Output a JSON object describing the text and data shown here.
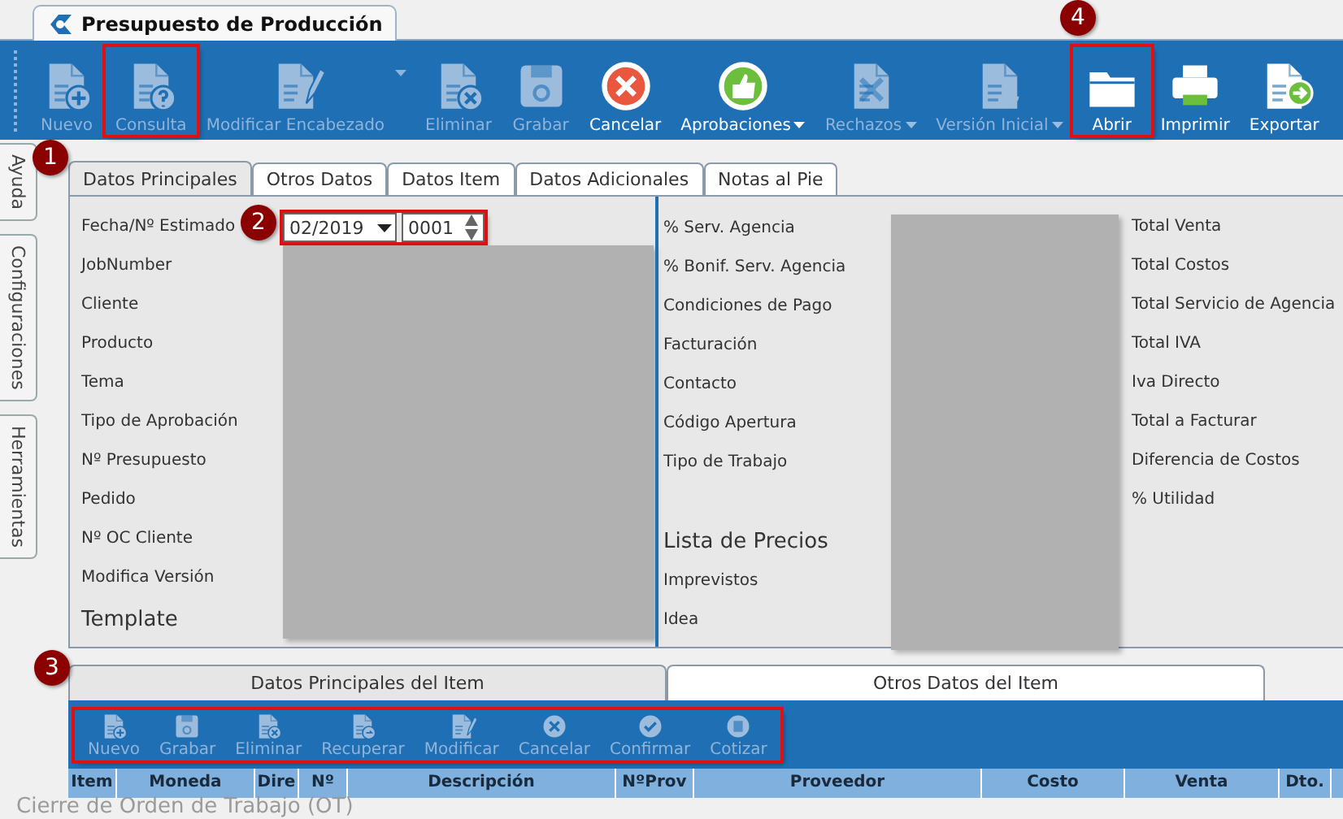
{
  "window": {
    "title": "Presupuesto de Producción"
  },
  "toolbar": [
    {
      "label": "Nuevo",
      "disabled": true,
      "highlighted": false
    },
    {
      "label": "Consulta",
      "disabled": true,
      "highlighted": true
    },
    {
      "label": "Modificar Encabezado",
      "disabled": true,
      "highlighted": false,
      "split_menu": true
    },
    {
      "label": "Eliminar",
      "disabled": true,
      "highlighted": false
    },
    {
      "label": "Grabar",
      "disabled": true,
      "highlighted": false
    },
    {
      "label": "Cancelar",
      "disabled": false,
      "highlighted": false
    },
    {
      "label": "Aprobaciones",
      "disabled": false,
      "highlighted": false,
      "dropdown": true
    },
    {
      "label": "Rechazos",
      "disabled": true,
      "highlighted": false,
      "dropdown": true
    },
    {
      "label": "Versión Inicial",
      "disabled": true,
      "highlighted": false,
      "dropdown": true
    },
    {
      "label": "Abrir",
      "disabled": false,
      "highlighted": true
    },
    {
      "label": "Imprimir",
      "disabled": false,
      "highlighted": false
    },
    {
      "label": "Exportar",
      "disabled": false,
      "highlighted": false
    }
  ],
  "side_tabs": [
    "Ayuda",
    "Configuraciones",
    "Herramientas"
  ],
  "tabs": [
    {
      "label": "Datos Principales",
      "selected": true
    },
    {
      "label": "Otros Datos",
      "selected": false
    },
    {
      "label": "Datos Item",
      "selected": false
    },
    {
      "label": "Datos Adicionales",
      "selected": false
    },
    {
      "label": "Notas al Pie",
      "selected": false
    }
  ],
  "form": {
    "left_labels": [
      "Fecha/Nº Estimado",
      "JobNumber",
      "Cliente",
      "Producto",
      "Tema",
      "Tipo de Aprobación",
      "Nº Presupuesto",
      "Pedido",
      "Nº OC Cliente",
      "Modifica Versión",
      "Template"
    ],
    "period": {
      "value": "02/2019"
    },
    "number": {
      "value": "0001"
    },
    "fields_highlighted": true,
    "middle_labels": [
      "% Serv. Agencia",
      "% Bonif. Serv. Agencia",
      "Condiciones de Pago",
      "Facturación",
      "Contacto",
      "Código Apertura",
      "Tipo de Trabajo"
    ],
    "price_list_heading": "Lista de Precios",
    "middle_labels_2": [
      "Imprevistos",
      "Idea"
    ],
    "totals_labels": [
      "Total Venta",
      "Total Costos",
      "Total Servicio de Agencia",
      "Total IVA",
      "Iva Directo",
      "Total a Facturar",
      "Diferencia de Costos",
      "% Utilidad"
    ]
  },
  "item_tabs": [
    {
      "label": "Datos Principales del Item",
      "selected": false
    },
    {
      "label": "Otros Datos del Item",
      "selected": true
    }
  ],
  "item_toolbar": {
    "highlighted": true,
    "buttons": [
      {
        "label": "Nuevo",
        "disabled": true
      },
      {
        "label": "Grabar",
        "disabled": true
      },
      {
        "label": "Eliminar",
        "disabled": true
      },
      {
        "label": "Recuperar",
        "disabled": true
      },
      {
        "label": "Modificar",
        "disabled": true
      },
      {
        "label": "Cancelar",
        "disabled": true
      },
      {
        "label": "Confirmar",
        "disabled": true
      },
      {
        "label": "Cotizar",
        "disabled": true
      }
    ]
  },
  "table": {
    "columns": [
      "Item",
      "Moneda",
      "Dire",
      "Nº",
      "Descripción",
      "NºProv",
      "Proveedor",
      "Costo",
      "Venta",
      "Dto."
    ]
  },
  "background_text": "Cierre de Orden de Trabajo (OT)",
  "callouts": [
    "1",
    "2",
    "3",
    "4"
  ]
}
